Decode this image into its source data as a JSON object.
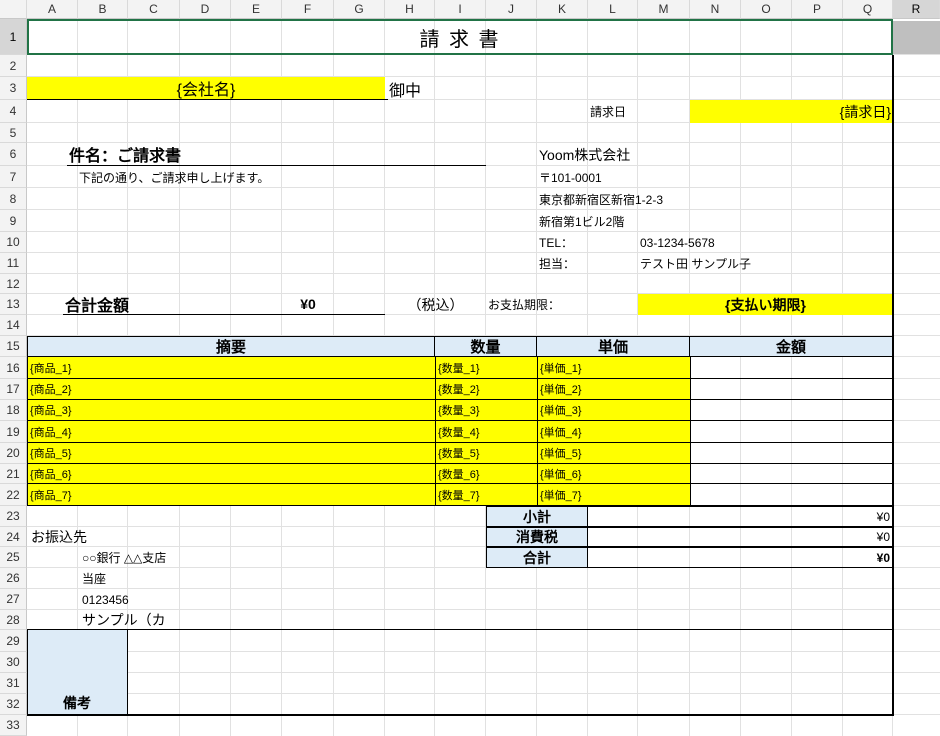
{
  "columns": [
    "A",
    "B",
    "C",
    "D",
    "E",
    "F",
    "G",
    "H",
    "I",
    "J",
    "K",
    "L",
    "M",
    "N",
    "O",
    "P",
    "Q",
    "R"
  ],
  "rows": [
    "1",
    "2",
    "3",
    "4",
    "5",
    "6",
    "7",
    "8",
    "9",
    "10",
    "11",
    "12",
    "13",
    "14",
    "15",
    "16",
    "17",
    "18",
    "19",
    "20",
    "21",
    "22",
    "23",
    "24",
    "25",
    "26",
    "27",
    "28",
    "29",
    "30",
    "31",
    "32",
    "33"
  ],
  "invoice": {
    "title": "請 求 書",
    "company_placeholder": "{会社名}",
    "onchu": "御中",
    "date_label": "請求日",
    "date_placeholder": "{請求日}",
    "subject": "件名：ご請求書",
    "intro": "下記の通り、ご請求申し上げます。",
    "issuer": {
      "name": "Yoom株式会社",
      "postal": "〒101-0001",
      "address1": "東京都新宿区新宿1-2-3",
      "address2": "新宿第1ビル2階",
      "tel_label": "TEL：",
      "tel": "03-1234-5678",
      "person_label": "担当：",
      "person": "テスト田 サンプル子"
    },
    "total_label": "合計金額",
    "total_value": "¥0",
    "tax_included": "（税込）",
    "due_label": "お支払期限：",
    "due_placeholder": "{支払い期限}",
    "table_headers": {
      "desc": "摘要",
      "qty": "数量",
      "unit_price": "単価",
      "amount": "金額"
    },
    "items": [
      {
        "desc": "{商品_1}",
        "qty": "{数量_1}",
        "price": "{単価_1}",
        "amount": ""
      },
      {
        "desc": "{商品_2}",
        "qty": "{数量_2}",
        "price": "{単価_2}",
        "amount": ""
      },
      {
        "desc": "{商品_3}",
        "qty": "{数量_3}",
        "price": "{単価_3}",
        "amount": ""
      },
      {
        "desc": "{商品_4}",
        "qty": "{数量_4}",
        "price": "{単価_4}",
        "amount": ""
      },
      {
        "desc": "{商品_5}",
        "qty": "{数量_5}",
        "price": "{単価_5}",
        "amount": ""
      },
      {
        "desc": "{商品_6}",
        "qty": "{数量_6}",
        "price": "{単価_6}",
        "amount": ""
      },
      {
        "desc": "{商品_7}",
        "qty": "{数量_7}",
        "price": "{単価_7}",
        "amount": ""
      }
    ],
    "summary": [
      {
        "label": "小計",
        "value": "¥0"
      },
      {
        "label": "消費税",
        "value": "¥0"
      },
      {
        "label": "合計",
        "value": "¥0"
      }
    ],
    "bank": {
      "heading": "お振込先",
      "bank_name": "○○銀行 △△支店",
      "account_type": "当座",
      "account_no": "0123456",
      "account_holder": "サンプル（カ"
    },
    "remarks_label": "備考"
  },
  "colors": {
    "yellow": "#ffff00",
    "header_blue": "#ddebf7",
    "selection_green": "#217346"
  }
}
